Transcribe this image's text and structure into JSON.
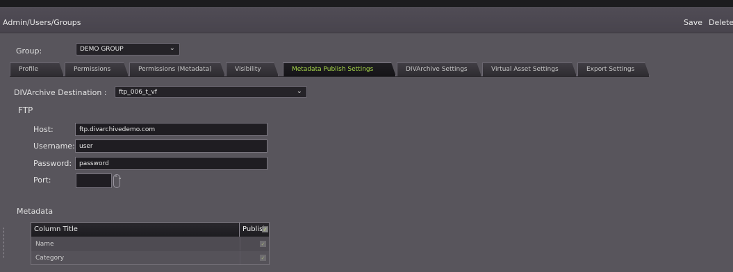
{
  "header": {
    "breadcrumb": "Admin/Users/Groups",
    "save_label": "Save",
    "delete_label": "Delete"
  },
  "group": {
    "label": "Group:",
    "selected": "DEMO GROUP",
    "chevron": "⌄"
  },
  "tabs": [
    {
      "label": "Profile",
      "active": false
    },
    {
      "label": "Permissions",
      "active": false
    },
    {
      "label": "Permissions (Metadata)",
      "active": false
    },
    {
      "label": "Visibility",
      "active": false
    },
    {
      "label": "Metadata Publish Settings",
      "active": true
    },
    {
      "label": "DIVArchive Settings",
      "active": false
    },
    {
      "label": "Virtual Asset Settings",
      "active": false
    },
    {
      "label": "Export Settings",
      "active": false
    }
  ],
  "destination": {
    "label": "DIVArchive Destination :",
    "selected": "ftp_006_t_vf",
    "chevron": "⌄"
  },
  "ftp": {
    "section_title": "FTP",
    "host_label": "Host:",
    "host_value": "ftp.divarchivedemo.com",
    "username_label": "Username:",
    "username_value": "user",
    "password_label": "Password:",
    "password_value": "password",
    "port_label": "Port:",
    "port_value": "",
    "spinner_glyph": "⌃⌄"
  },
  "metadata": {
    "section_title": "Metadata",
    "columns": [
      "Column Title",
      "Publish"
    ],
    "publish_all_checked": true,
    "check_glyph": "✓",
    "rows": [
      {
        "name": "Name",
        "publish": true
      },
      {
        "name": "Category",
        "publish": true
      }
    ]
  },
  "colors": {
    "background": "#58555c",
    "active_tab_text": "#a8d84a",
    "input_bg": "#1f1d22"
  }
}
